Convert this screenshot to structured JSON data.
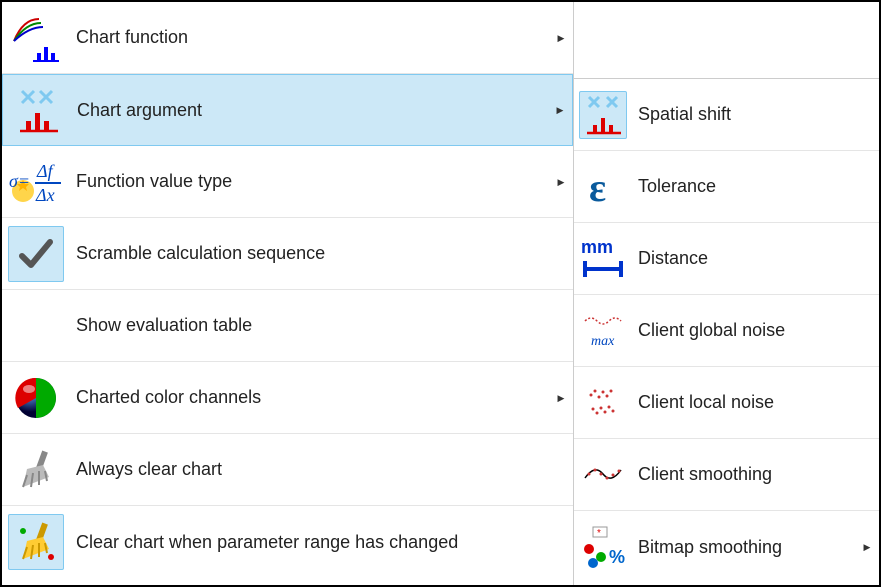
{
  "left_menu": {
    "items": [
      {
        "label": "Chart function",
        "has_submenu": true
      },
      {
        "label": "Chart argument",
        "has_submenu": true,
        "highlighted": true
      },
      {
        "label": "Function value type",
        "has_submenu": true
      },
      {
        "label": "Scramble calculation sequence",
        "has_submenu": false,
        "icon_selected": true
      },
      {
        "label": "Show evaluation table",
        "has_submenu": false
      },
      {
        "label": "Charted color channels",
        "has_submenu": true
      },
      {
        "label": "Always clear chart",
        "has_submenu": false
      },
      {
        "label": "Clear chart when parameter range has changed",
        "has_submenu": false,
        "icon_selected": true
      }
    ]
  },
  "right_menu": {
    "items": [
      {
        "label": "Spatial shift",
        "highlighted": true
      },
      {
        "label": "Tolerance"
      },
      {
        "label": "Distance"
      },
      {
        "label": "Client global noise"
      },
      {
        "label": "Client local noise"
      },
      {
        "label": "Client smoothing"
      },
      {
        "label": "Bitmap smoothing",
        "has_submenu": true
      }
    ]
  }
}
